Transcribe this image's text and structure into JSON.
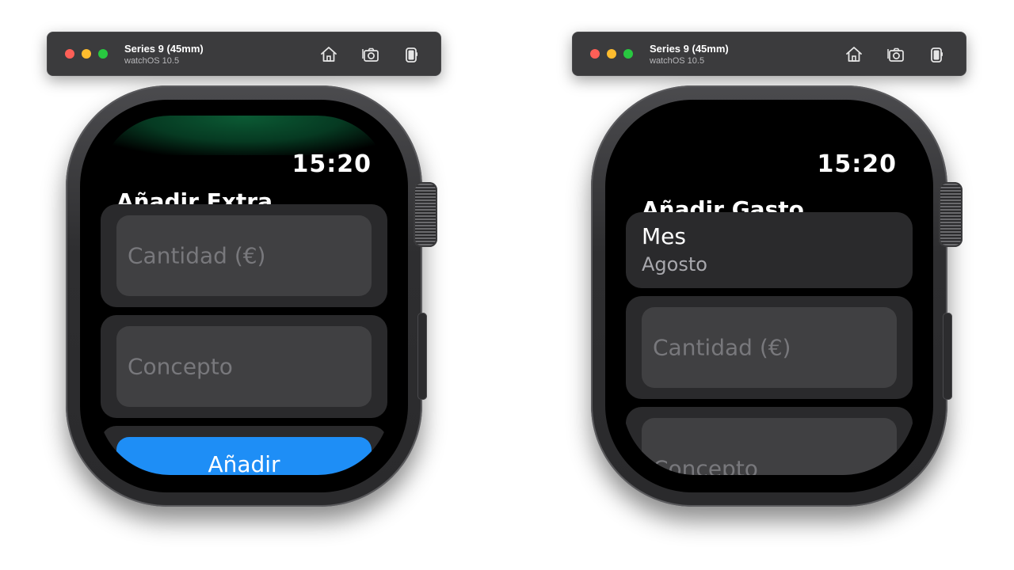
{
  "simulators": [
    {
      "device_name": "Series 9 (45mm)",
      "os_version": "watchOS 10.5",
      "toolbar": {
        "home_icon": "home-icon",
        "screenshot_icon": "camera-icon",
        "rotate_icon": "rotate-device-icon"
      },
      "screen": {
        "time": "15:20",
        "title": "Añadir Extra",
        "fields": [
          {
            "placeholder": "Cantidad (€)"
          },
          {
            "placeholder": "Concepto"
          }
        ],
        "button_label": "Añadir"
      }
    },
    {
      "device_name": "Series 9 (45mm)",
      "os_version": "watchOS 10.5",
      "toolbar": {
        "home_icon": "home-icon",
        "screenshot_icon": "camera-icon",
        "rotate_icon": "rotate-device-icon"
      },
      "screen": {
        "time": "15:20",
        "title": "Añadir Gasto",
        "picker": {
          "label": "Mes",
          "value": "Agosto"
        },
        "fields": [
          {
            "placeholder": "Cantidad (€)"
          },
          {
            "placeholder": "Concepto"
          }
        ]
      }
    }
  ],
  "colors": {
    "accent_button": "#1e8ef6",
    "traffic_red": "#fe5f57",
    "traffic_yellow": "#febc2e",
    "traffic_green": "#28c840"
  }
}
